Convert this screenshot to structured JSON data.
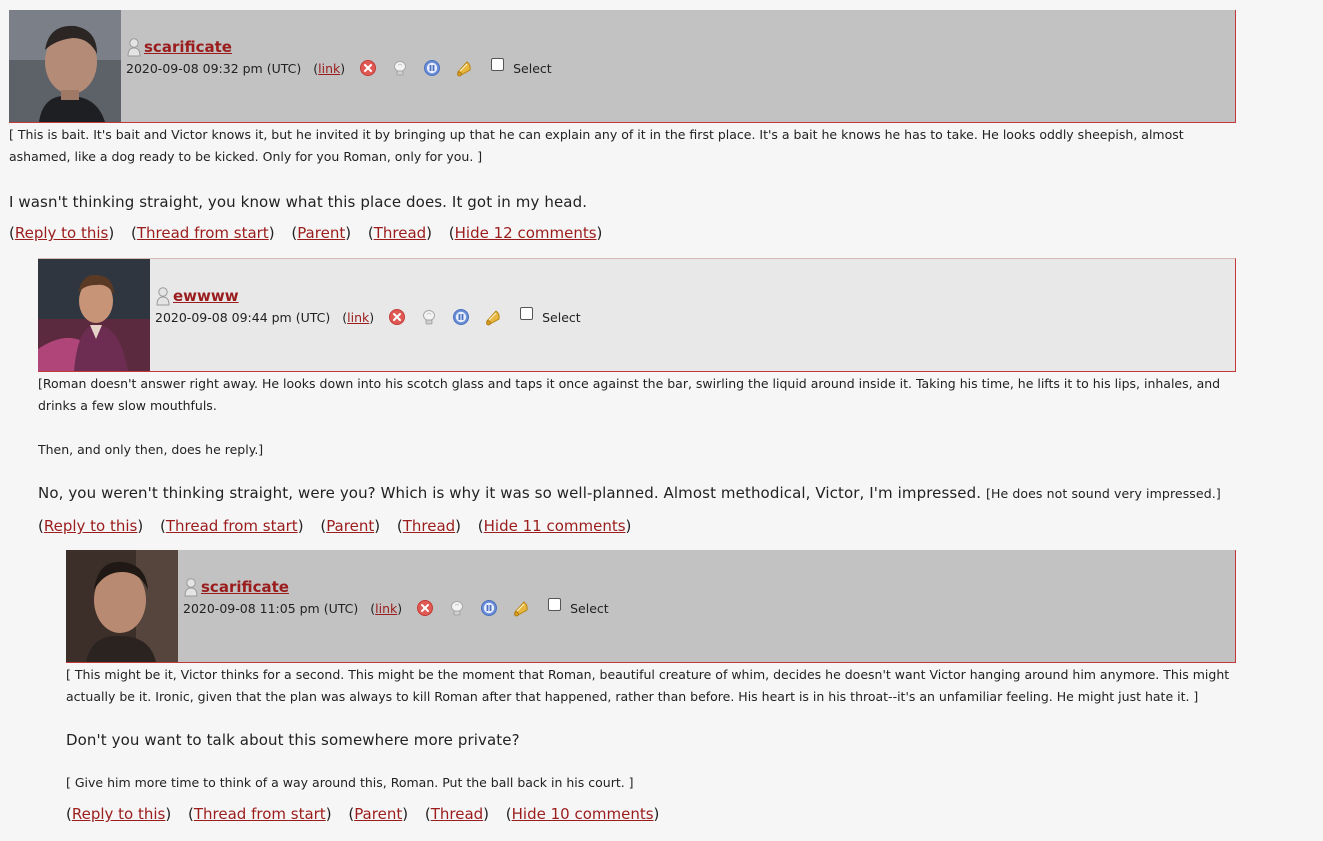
{
  "comments": [
    {
      "username": "scarificate",
      "date": "2020-09-08 09:32 pm (UTC)",
      "link_label": "link",
      "select_label": "Select",
      "subtext": "[ This is bait. It's bait and Victor knows it, but he invited it by bringing up that he can explain any of it in the first place. It's a bait he knows he has to take. He looks oddly sheepish, almost ashamed, like a dog ready to be kicked. Only for you Roman, only for you. ]",
      "body": "I wasn't thinking straight, you know what this place does. It got in my head.",
      "links": [
        "Reply to this",
        "Thread from start",
        "Parent",
        "Thread",
        "Hide 12 comments"
      ]
    },
    {
      "username": "ewwww",
      "date": "2020-09-08 09:44 pm (UTC)",
      "link_label": "link",
      "select_label": "Select",
      "subtext": "[Roman doesn't answer right away. He looks down into his scotch glass and taps it once against the bar, swirling the liquid around inside it. Taking his time, he lifts it to his lips, inhales, and drinks a few slow mouthfuls.",
      "subtext2": "Then, and only then, does he reply.]",
      "body": "No, you weren't thinking straight, were you? Which is why it was so well-planned. Almost methodical, Victor, I'm impressed.",
      "body_small": "[He does not sound very impressed.]",
      "links": [
        "Reply to this",
        "Thread from start",
        "Parent",
        "Thread",
        "Hide 11 comments"
      ]
    },
    {
      "username": "scarificate",
      "date": "2020-09-08 11:05 pm (UTC)",
      "link_label": "link",
      "select_label": "Select",
      "subtext": "[ This might be it, Victor thinks for a second. This might be the moment that Roman, beautiful creature of whim, decides he doesn't want Victor hanging around him anymore. This might actually be it. Ironic, given that the plan was always to kill Roman after that happened, rather than before. His heart is in his throat--it's an unfamiliar feeling. He might just hate it. ]",
      "body": "Don't you want to talk about this somewhere more private?",
      "subtext2": "[ Give him more time to think of a way around this, Roman. Put the ball back in his court. ]",
      "links": [
        "Reply to this",
        "Thread from start",
        "Parent",
        "Thread",
        "Hide 10 comments"
      ]
    }
  ],
  "icons": {
    "user": "user-icon",
    "delete": "delete-icon",
    "screen": "screen-icon",
    "freeze": "freeze-icon",
    "track": "track-icon"
  },
  "colors": {
    "link": "#9b1c1c",
    "header_dark": "#c2c2c2",
    "header_light": "#e8e8e8",
    "border": "#c0393b"
  }
}
